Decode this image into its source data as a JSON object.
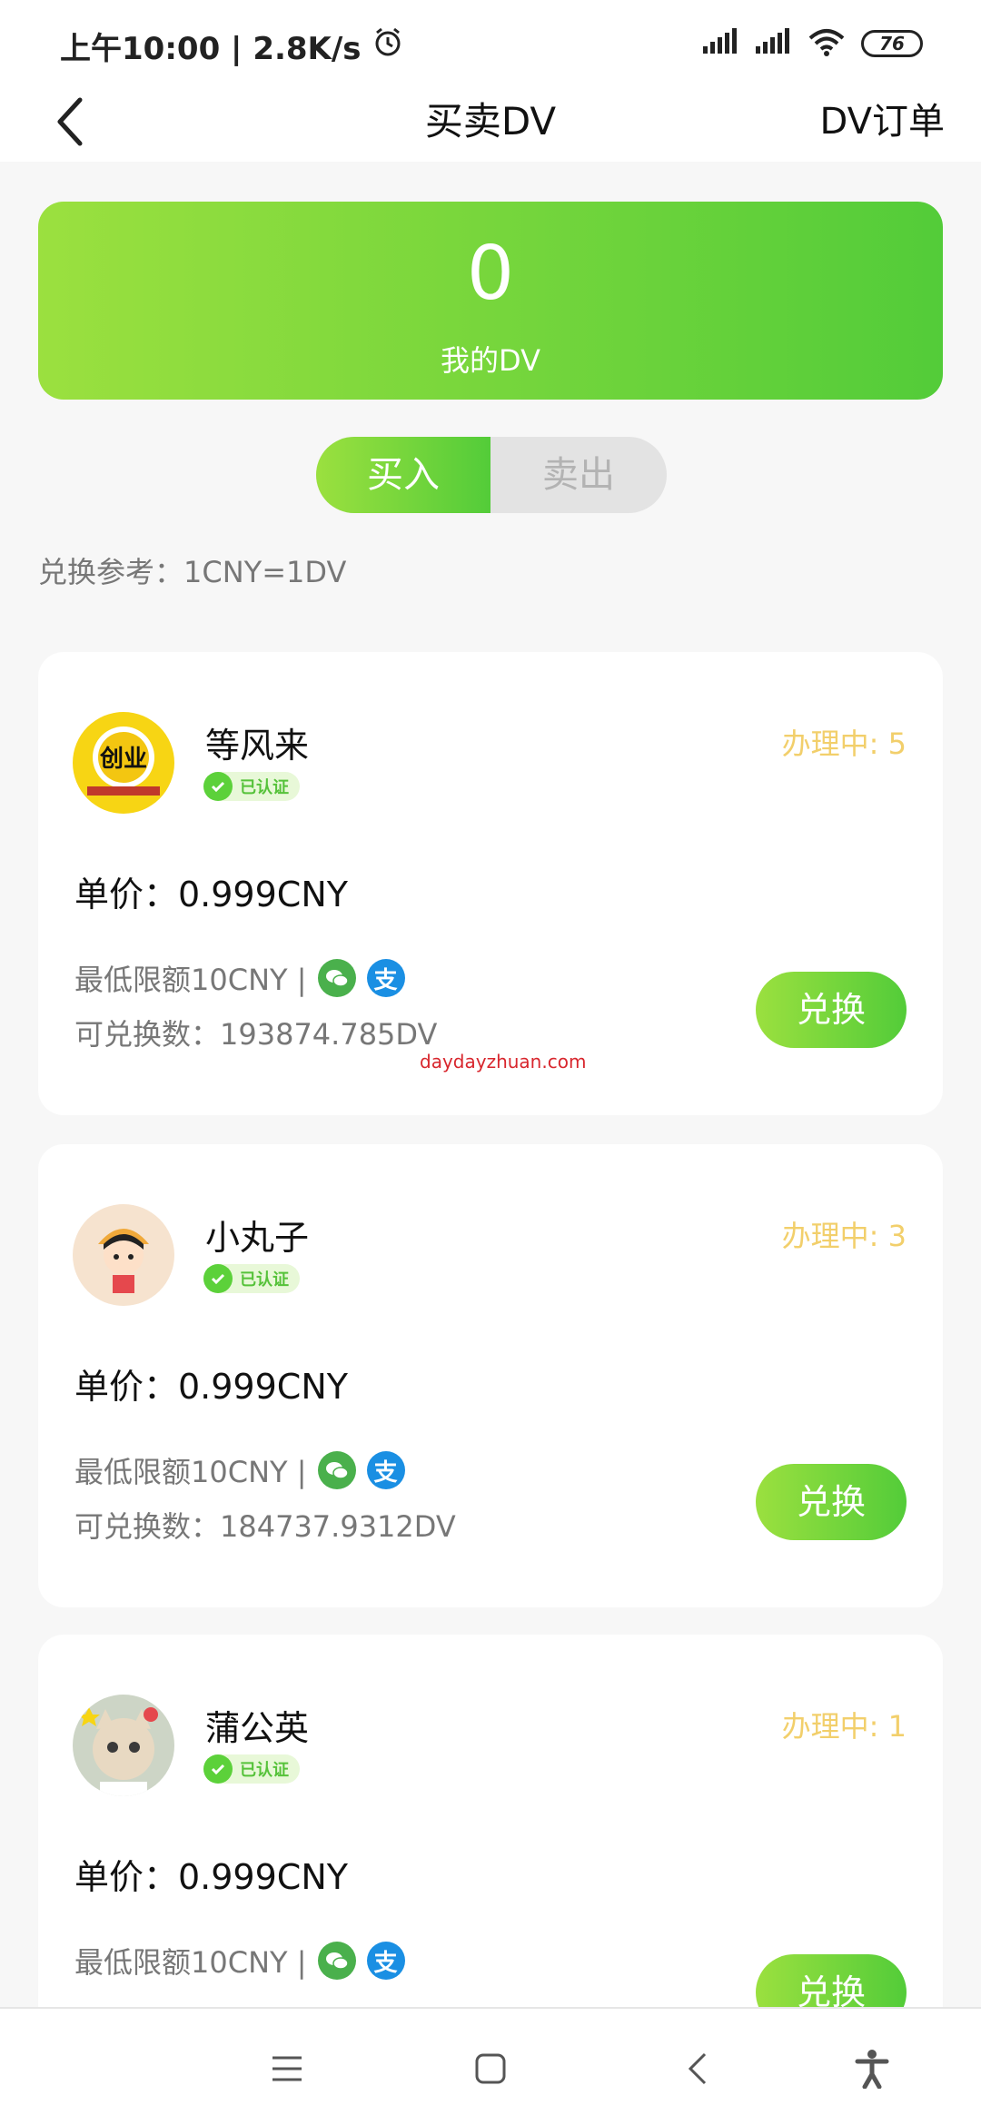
{
  "status_bar": {
    "time": "上午10:00 | 2.8K/s",
    "battery": "76"
  },
  "header": {
    "title": "买卖DV",
    "orders_link": "DV订单"
  },
  "balance": {
    "value": "0",
    "label": "我的DV"
  },
  "toggle": {
    "buy": "买入",
    "sell": "卖出",
    "selected": "买入"
  },
  "reference": "兑换参考：1CNY=1DV",
  "sellers": [
    {
      "name": "等风来",
      "verified": "已认证",
      "processing": "办理中: 5",
      "price": "单价：0.999CNY",
      "min_limit": "最低限额10CNY |",
      "available": "可兑换数：193874.785DV",
      "button": "兑换",
      "avatar_text": "创业"
    },
    {
      "name": "小丸子",
      "verified": "已认证",
      "processing": "办理中: 3",
      "price": "单价：0.999CNY",
      "min_limit": "最低限额10CNY |",
      "available": "可兑换数：184737.9312DV",
      "button": "兑换"
    },
    {
      "name": "蒲公英",
      "verified": "已认证",
      "processing": "办理中: 1",
      "price": "单价：0.999CNY",
      "min_limit": "最低限额10CNY |",
      "available": "",
      "button": "兑换"
    }
  ],
  "payment_icons": {
    "wechat": "wechat-icon",
    "alipay_glyph": "支"
  },
  "watermark": "daydayzhuan.com",
  "colors": {
    "accent_start": "#9be03f",
    "accent_end": "#53cc39",
    "processing": "#f2cf6b"
  }
}
